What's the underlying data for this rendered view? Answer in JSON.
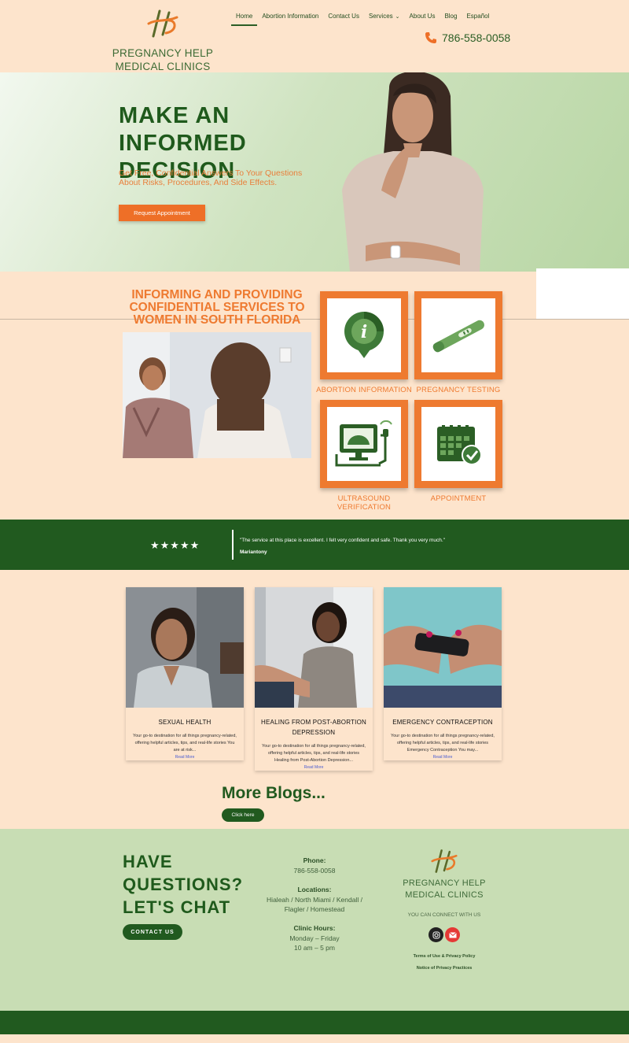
{
  "brand": {
    "name_line1": "PREGNANCY HELP",
    "name_line2": "MEDICAL CLINICS"
  },
  "nav": {
    "items": [
      "Home",
      "Abortion Information",
      "Contact Us",
      "Services",
      "About Us",
      "Blog",
      "Español"
    ],
    "active": "Home"
  },
  "header": {
    "phone": "786-558-0058"
  },
  "hero": {
    "title": "MAKE AN INFORMED DECISION",
    "subtitle": "Get Free, Confidential Answers To Your Questions About Risks, Procedures, And Side Effects.",
    "cta": "Request Appointment"
  },
  "services": {
    "title": "INFORMING AND PROVIDING CONFIDENTIAL SERVICES TO WOMEN IN SOUTH FLORIDA",
    "tiles": [
      {
        "label": "ABORTION INFORMATION",
        "icon": "info-pin-icon"
      },
      {
        "label": "PREGNANCY TESTING",
        "icon": "pregnancy-test-icon"
      },
      {
        "label": "ULTRASOUND VERIFICATION",
        "icon": "ultrasound-machine-icon"
      },
      {
        "label": "APPOINTMENT",
        "icon": "calendar-check-icon"
      }
    ]
  },
  "testimonial": {
    "stars": "★★★★★",
    "quote": "\"The service at this place is excellent. I felt very confident and safe. Thank you very much.\"",
    "author": "Mariantony"
  },
  "blogs": [
    {
      "title": "SEXUAL HEALTH",
      "desc": "Your go-to destination for all things pregnancy-related, offering helpful articles, tips, and real-life stories You are at risk...",
      "more": "Read More"
    },
    {
      "title": "HEALING FROM POST-ABORTION DEPRESSION",
      "desc": "Your go-to destination for all things pregnancy-related, offering helpful articles, tips, and real-life stories Healing from Post-Abortion Depression...",
      "more": "Read More"
    },
    {
      "title": "EMERGENCY CONTRACEPTION",
      "desc": "Your go-to destination for all things pregnancy-related, offering helpful articles, tips, and real-life stories Emergency Contraception You may...",
      "more": "Read More"
    }
  ],
  "more_blogs": {
    "title": "More Blogs...",
    "cta": "Click here"
  },
  "footer": {
    "ask_line1": "HAVE",
    "ask_line2": "QUESTIONS?",
    "ask_line3": "LET'S CHAT",
    "contact_cta": "CONTACT US",
    "phone_label": "Phone:",
    "phone": "786-558-0058",
    "locations_label": "Locations:",
    "locations_line1": "Hialeah / North Miami / Kendall /",
    "locations_line2": "Flagler / Homestead",
    "hours_label": "Clinic Hours:",
    "hours_days": "Monday – Friday",
    "hours_time": "10 am – 5 pm",
    "connect": "YOU CAN CONNECT WITH US",
    "terms": "Terms of Use & Privacy Policy",
    "notice": "Notice of Privacy Practices"
  },
  "colors": {
    "peach": "#fde4cc",
    "green": "#215a1f",
    "orange": "#ee7a30",
    "sage": "#c8ddb4"
  }
}
